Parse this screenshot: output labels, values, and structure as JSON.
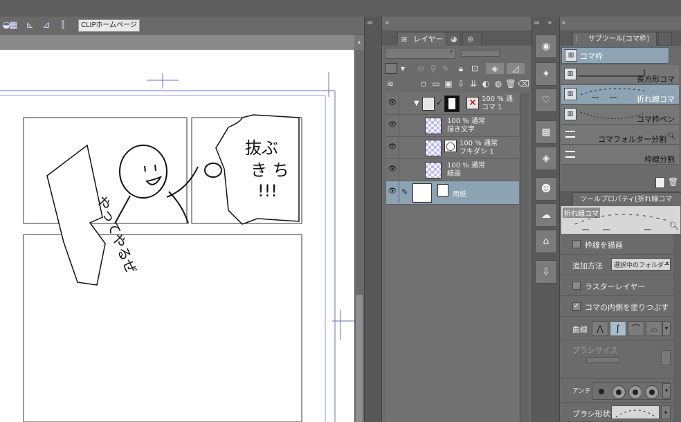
{
  "toolbar": {
    "icons": [
      "grid-icon",
      "ruler-icon",
      "ruler-edge-icon",
      "snap-icon"
    ],
    "clip_home_label": "CLIPホームページ"
  },
  "canvas": {
    "scroll_up_glyph": "▴",
    "speech_text": "抜ぶちき!!!",
    "sign_text": "やってやるぜ"
  },
  "layers_panel": {
    "tabs": [
      {
        "label": "レイヤー",
        "icon": "layers-icon"
      },
      {
        "label": "",
        "icon": "navigator-icon"
      },
      {
        "label": "",
        "icon": "material-icon"
      }
    ],
    "layers": [
      {
        "opacity_mode": "100 % 通",
        "name": "コマ 1",
        "type": "frame-folder",
        "visible": true
      },
      {
        "opacity_mode": "100 % 通常",
        "name": "描き文字",
        "type": "raster",
        "visible": true
      },
      {
        "opacity_mode": "100 % 通常",
        "name": "フキダシ 1",
        "type": "balloon",
        "visible": true
      },
      {
        "opacity_mode": "100 % 通常",
        "name": "線画",
        "type": "raster",
        "visible": true
      },
      {
        "opacity_mode": "",
        "name": "用紙",
        "type": "paper",
        "visible": true,
        "selected": true
      }
    ]
  },
  "subtool_panel": {
    "title": "サブツール[コマ枠]",
    "active_group": "コマ枠",
    "items": [
      {
        "name": "長方形コマ",
        "selected": false
      },
      {
        "name": "折れ線コマ",
        "selected": true
      },
      {
        "name": "コマ枠ペン",
        "selected": false
      },
      {
        "name": "コマフォルダー分割",
        "selected": false
      },
      {
        "name": "枠線分割",
        "selected": false
      }
    ]
  },
  "tool_property": {
    "title": "ツールプロパティ[折れ線コマ",
    "preview_label": "折れ線コマ",
    "draw_border": {
      "label": "枠線を描画",
      "checked": false
    },
    "add_method": {
      "label": "追加方法",
      "value": "選択中のフォルダー"
    },
    "raster_layer": {
      "label": "ラスターレイヤー",
      "checked": false
    },
    "fill_inside": {
      "label": "コマの内側を塗りつぶす",
      "checked": true
    },
    "curve": {
      "label": "曲線",
      "options": [
        "straight",
        "spline",
        "quadratic",
        "cubic"
      ],
      "selected": 1
    },
    "brush_size": {
      "label": "ブラシサイズ"
    },
    "antialias": {
      "label": "アンチ",
      "selected": 0
    },
    "brush_shape": {
      "label": "ブラシ形状"
    }
  }
}
